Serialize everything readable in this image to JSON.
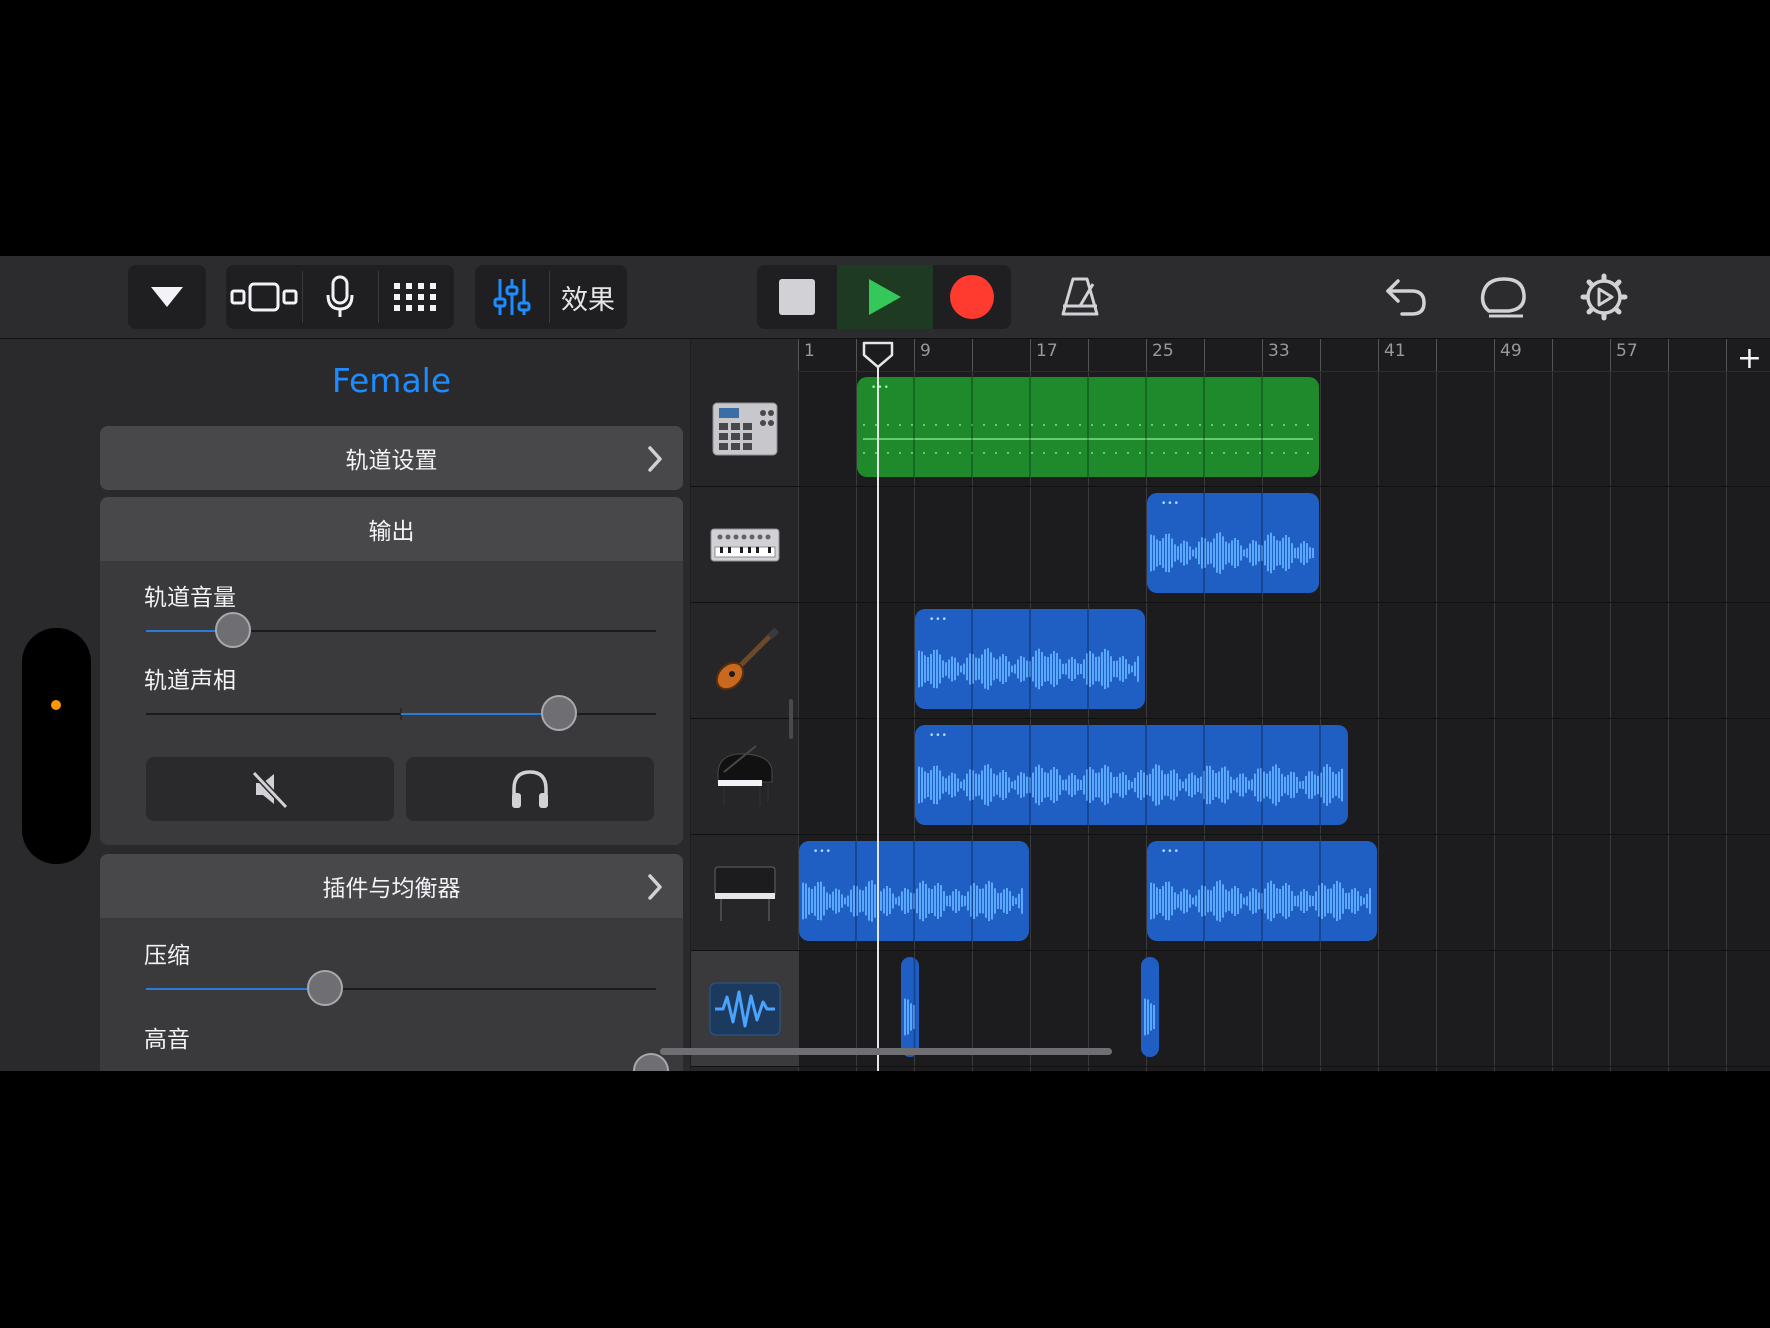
{
  "toolbar": {
    "effects_label": "效果",
    "colors": {
      "accent": "#1d8cff",
      "play": "#34c759",
      "record": "#ff3b30"
    }
  },
  "inspector": {
    "track_name": "Female",
    "track_settings": {
      "label": "轨道设置"
    },
    "output": {
      "label": "输出",
      "volume_label": "轨道音量",
      "volume_level": 0.17,
      "pan_label": "轨道声相",
      "pan_level": 0.81
    },
    "plugins": {
      "label": "插件与均衡器",
      "compression_label": "压缩",
      "compression_level": 0.35,
      "treble_label": "高音",
      "treble_level": 0.99
    }
  },
  "timeline": {
    "bar_numbers": [
      "1",
      "9",
      "17",
      "25",
      "33",
      "41",
      "49",
      "57"
    ],
    "playhead_bar": 6.5,
    "tracks": [
      {
        "instrument_icon": "drum-machine-icon",
        "region_color": "green",
        "regions": [
          [
            5,
            37
          ]
        ]
      },
      {
        "instrument_icon": "synth-keyboard-icon",
        "region_color": "blue",
        "regions": [
          [
            25,
            37
          ]
        ]
      },
      {
        "instrument_icon": "bass-guitar-icon",
        "region_color": "blue",
        "regions": [
          [
            9,
            25
          ]
        ]
      },
      {
        "instrument_icon": "grand-piano-icon",
        "region_color": "blue",
        "regions": [
          [
            9,
            39
          ]
        ]
      },
      {
        "instrument_icon": "upright-piano-icon",
        "region_color": "blue",
        "regions": [
          [
            1,
            17
          ],
          [
            25,
            41
          ]
        ]
      },
      {
        "instrument_icon": "audio-recorder-icon",
        "region_color": "blue",
        "selected": true,
        "regions": [
          [
            8,
            9.2
          ],
          [
            24.6,
            26
          ]
        ]
      }
    ]
  }
}
